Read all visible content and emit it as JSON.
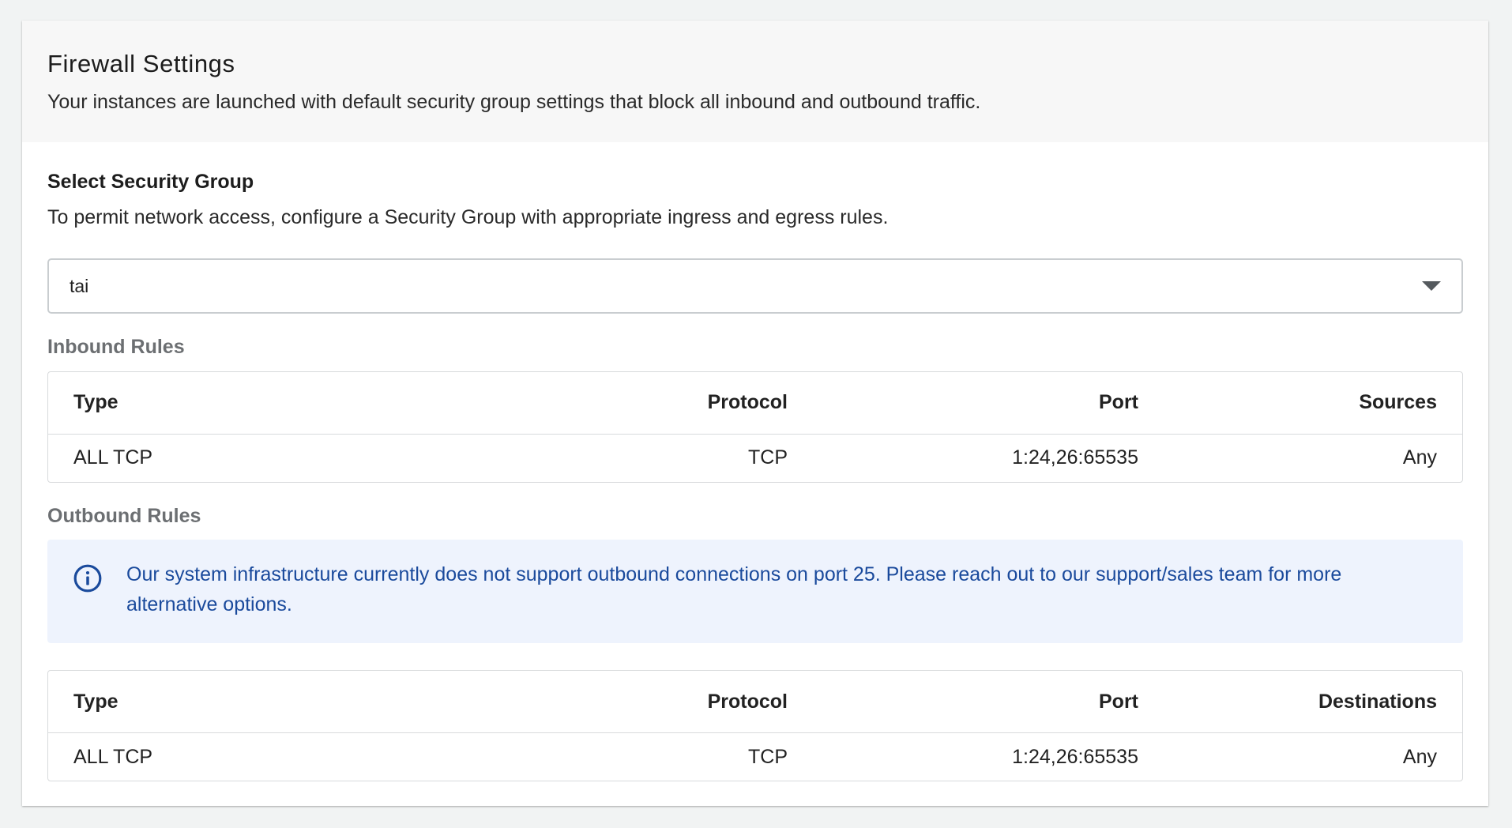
{
  "header": {
    "title": "Firewall Settings",
    "description": "Your instances are launched with default security group settings that block all inbound and outbound traffic."
  },
  "security_group": {
    "title": "Select Security Group",
    "description": "To permit network access, configure a Security Group with appropriate ingress and egress rules.",
    "selected": "tai",
    "dropdown_icon": "caret-down-icon"
  },
  "inbound": {
    "label": "Inbound Rules",
    "columns": [
      "Type",
      "Protocol",
      "Port",
      "Sources"
    ],
    "rows": [
      {
        "type": "ALL TCP",
        "protocol": "TCP",
        "port": "1:24,26:65535",
        "source": "Any"
      }
    ]
  },
  "outbound": {
    "label": "Outbound Rules",
    "notice": {
      "icon": "info-icon",
      "text": "Our system infrastructure currently does not support outbound connections on port 25. Please reach out to our support/sales team for more alternative options."
    },
    "columns": [
      "Type",
      "Protocol",
      "Port",
      "Destinations"
    ],
    "rows": [
      {
        "type": "ALL TCP",
        "protocol": "TCP",
        "port": "1:24,26:65535",
        "destination": "Any"
      }
    ]
  },
  "colors": {
    "page_background": "#f1f3f3",
    "header_background": "#f7f7f7",
    "notice_background": "#eef3fd",
    "notice_text": "#1a4a9c",
    "muted_label": "#6c6f72"
  }
}
